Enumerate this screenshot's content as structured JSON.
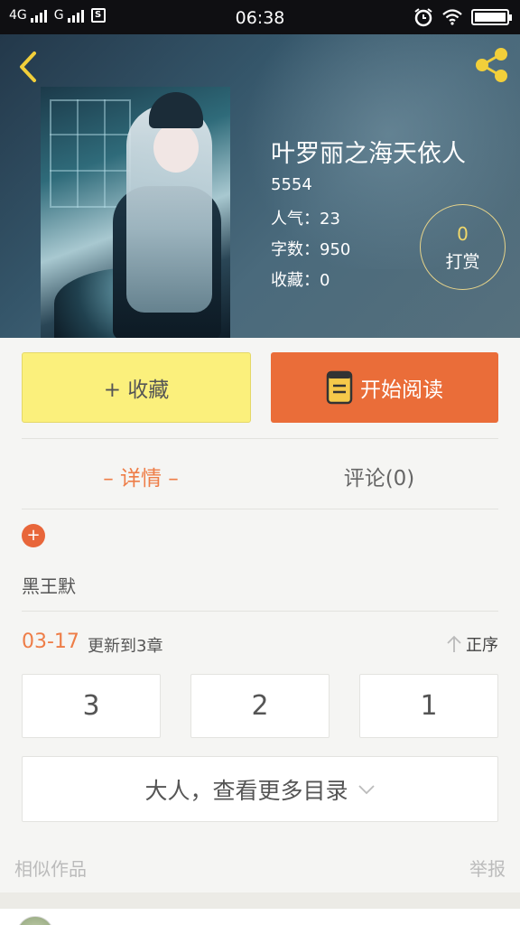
{
  "status_bar": {
    "carrier_1": "4G",
    "carrier_2": "G",
    "sim_icon": "S",
    "time": "06:38",
    "icons": [
      "alarm-icon",
      "wifi-icon",
      "battery-icon"
    ]
  },
  "header": {
    "back_icon": "chevron-left-icon",
    "share_icon": "share-icon"
  },
  "book": {
    "title": "叶罗丽之海天依人",
    "id_line": "5554",
    "popularity": "人气：23",
    "word_count": "字数：950",
    "favorites": "收藏：0",
    "reward_count": "0",
    "reward_label": "打赏"
  },
  "actions": {
    "collect_label": "+ 收藏",
    "read_label": "开始阅读"
  },
  "tabs": {
    "detail": "– 详情 –",
    "comments": "评论(0)"
  },
  "details": {
    "expand_symbol": "+",
    "author": "黑王默"
  },
  "updates": {
    "date": "03-17",
    "text": "更新到3章",
    "sort_label": "正序"
  },
  "chapters": [
    "3",
    "2",
    "1"
  ],
  "more_toc_label": "大人，查看更多目录",
  "footer": {
    "similar": "相似作品",
    "report": "举报"
  },
  "colors": {
    "accent_orange": "#ea6d39",
    "collect_yellow": "#fbf07c",
    "reward_gold": "#f1d96b"
  }
}
